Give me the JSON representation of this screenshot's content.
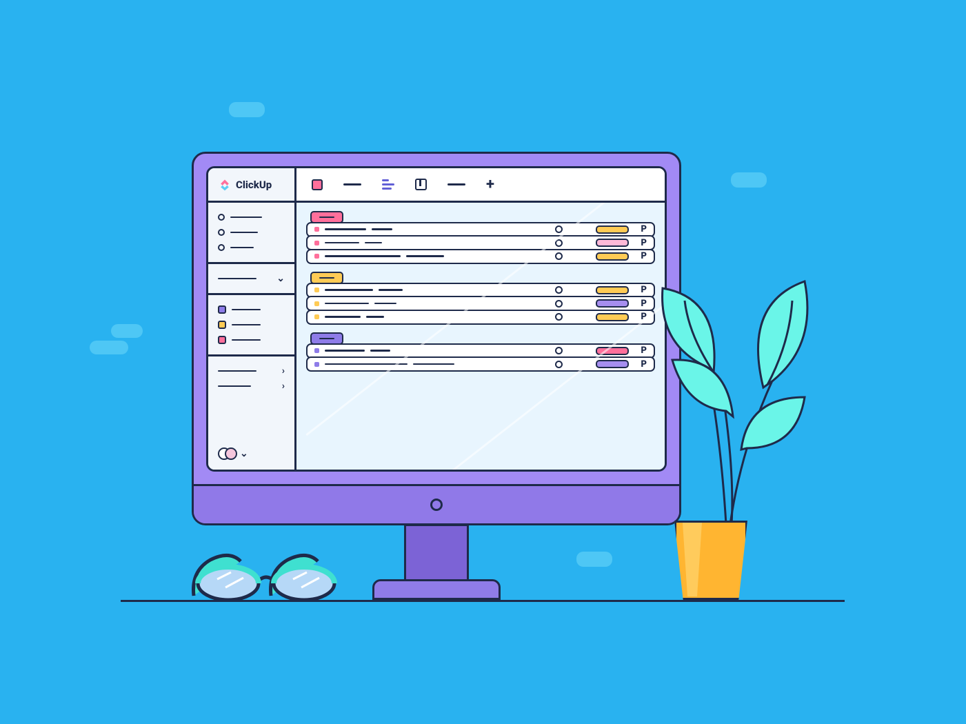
{
  "app": {
    "name": "ClickUp"
  },
  "colors": {
    "pink": "#FF6F9B",
    "yellow": "#FFCB55",
    "purple": "#8E7CE8",
    "violet": "#A68EEF",
    "navy": "#1E2A4A",
    "bg": "#29B2F0",
    "cloud": "#4EC7F5"
  },
  "sidebar": {
    "nav_items": [
      "",
      "",
      ""
    ],
    "spaces": [
      {
        "color": "#8E7CE8"
      },
      {
        "color": "#FFCB55"
      },
      {
        "color": "#FF6F9B"
      }
    ],
    "folders": [
      "",
      ""
    ]
  },
  "topbar": {
    "views": [
      "list",
      "line",
      "gantt",
      "board",
      "line",
      "add"
    ]
  },
  "content": {
    "groups": [
      {
        "tab_color": "#FF6F9B",
        "tasks": [
          {
            "status": "#FF6F9B",
            "pill": "#FFCB55",
            "flag": "P"
          },
          {
            "status": "#FF6F9B",
            "pill": "#FFB9D7",
            "flag": "P"
          },
          {
            "status": "#FF6F9B",
            "pill": "#FFCB55",
            "flag": "P"
          }
        ]
      },
      {
        "tab_color": "#FFCB55",
        "tasks": [
          {
            "status": "#FFCB55",
            "pill": "#FFCB55",
            "flag": "P"
          },
          {
            "status": "#FFCB55",
            "pill": "#A68EEF",
            "flag": "P"
          },
          {
            "status": "#FFCB55",
            "pill": "#FFCB55",
            "flag": "P"
          }
        ]
      },
      {
        "tab_color": "#8E7CE8",
        "tasks": [
          {
            "status": "#8E7CE8",
            "pill": "#FF6F9B",
            "flag": "P"
          },
          {
            "status": "#8E7CE8",
            "pill": "#A68EEF",
            "flag": "P"
          }
        ]
      }
    ]
  }
}
